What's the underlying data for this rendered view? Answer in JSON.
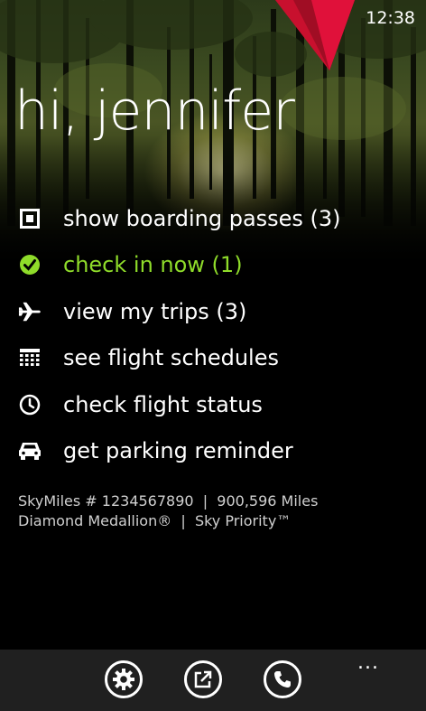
{
  "status_bar": {
    "time": "12:38"
  },
  "greeting": "hi, jennifer",
  "menu": {
    "items": [
      {
        "label": "show boarding passes (3)",
        "icon": "boarding-pass-icon"
      },
      {
        "label": "check in now (1)",
        "icon": "check-circle-icon",
        "color": "#8fdc2a"
      },
      {
        "label": "view my trips (3)",
        "icon": "airplane-icon"
      },
      {
        "label": "see flight schedules",
        "icon": "calendar-grid-icon"
      },
      {
        "label": "check flight status",
        "icon": "clock-icon"
      },
      {
        "label": "get parking reminder",
        "icon": "car-icon"
      }
    ]
  },
  "account": {
    "line1": "SkyMiles # 1234567890  |  900,596 Miles",
    "line2": "Diamond Medallion®  |  Sky Priority™"
  },
  "app_bar": {
    "buttons": [
      {
        "icon": "settings-gear-icon"
      },
      {
        "icon": "share-open-icon"
      },
      {
        "icon": "phone-icon"
      }
    ],
    "more": "..."
  },
  "colors": {
    "accent_green": "#8fdc2a",
    "brand_red": "#c8102e",
    "app_bar": "#202020"
  }
}
